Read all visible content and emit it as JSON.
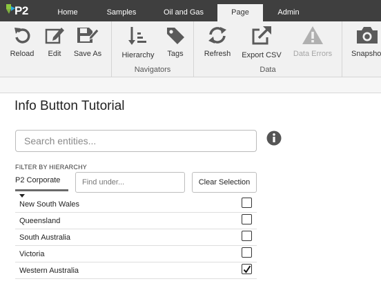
{
  "app": {
    "logo_text": "P2"
  },
  "tabs": [
    {
      "label": "Home",
      "active": false
    },
    {
      "label": "Samples",
      "active": false
    },
    {
      "label": "Oil and Gas",
      "active": false
    },
    {
      "label": "Page",
      "active": true
    },
    {
      "label": "Admin",
      "active": false
    }
  ],
  "ribbon": {
    "buttons": {
      "reload": {
        "label": "Reload",
        "icon": "reload-icon"
      },
      "edit": {
        "label": "Edit",
        "icon": "edit-icon"
      },
      "save_as": {
        "label": "Save As",
        "icon": "save-as-icon"
      },
      "hierarchy": {
        "label": "Hierarchy",
        "icon": "hierarchy-sort-icon"
      },
      "tags": {
        "label": "Tags",
        "icon": "tag-icon"
      },
      "refresh": {
        "label": "Refresh",
        "icon": "refresh-icon"
      },
      "export_csv": {
        "label": "Export CSV",
        "icon": "export-icon"
      },
      "data_errors": {
        "label": "Data Errors",
        "icon": "warning-icon",
        "disabled": true
      },
      "snapshot": {
        "label": "Snapshot",
        "icon": "camera-icon"
      }
    },
    "groups": {
      "navigators": "Navigators",
      "data": "Data"
    }
  },
  "page": {
    "title": "Info Button Tutorial",
    "search_placeholder": "Search entities...",
    "filter_label": "FILTER BY HIERARCHY",
    "hierarchy_selected": "P2 Corporate",
    "find_placeholder": "Find under...",
    "clear_button": "Clear Selection",
    "entities": [
      {
        "name": "New South Wales",
        "checked": false
      },
      {
        "name": "Queensland",
        "checked": false
      },
      {
        "name": "South Australia",
        "checked": false
      },
      {
        "name": "Victoria",
        "checked": false
      },
      {
        "name": "Western Australia",
        "checked": true
      }
    ]
  },
  "colors": {
    "tab_bar": "#3f3f3f",
    "ribbon_bg": "#f1f1f1",
    "icon_gray": "#5a5a5a",
    "logo_green": "#8cc63f",
    "logo_blue": "#29a8df"
  }
}
